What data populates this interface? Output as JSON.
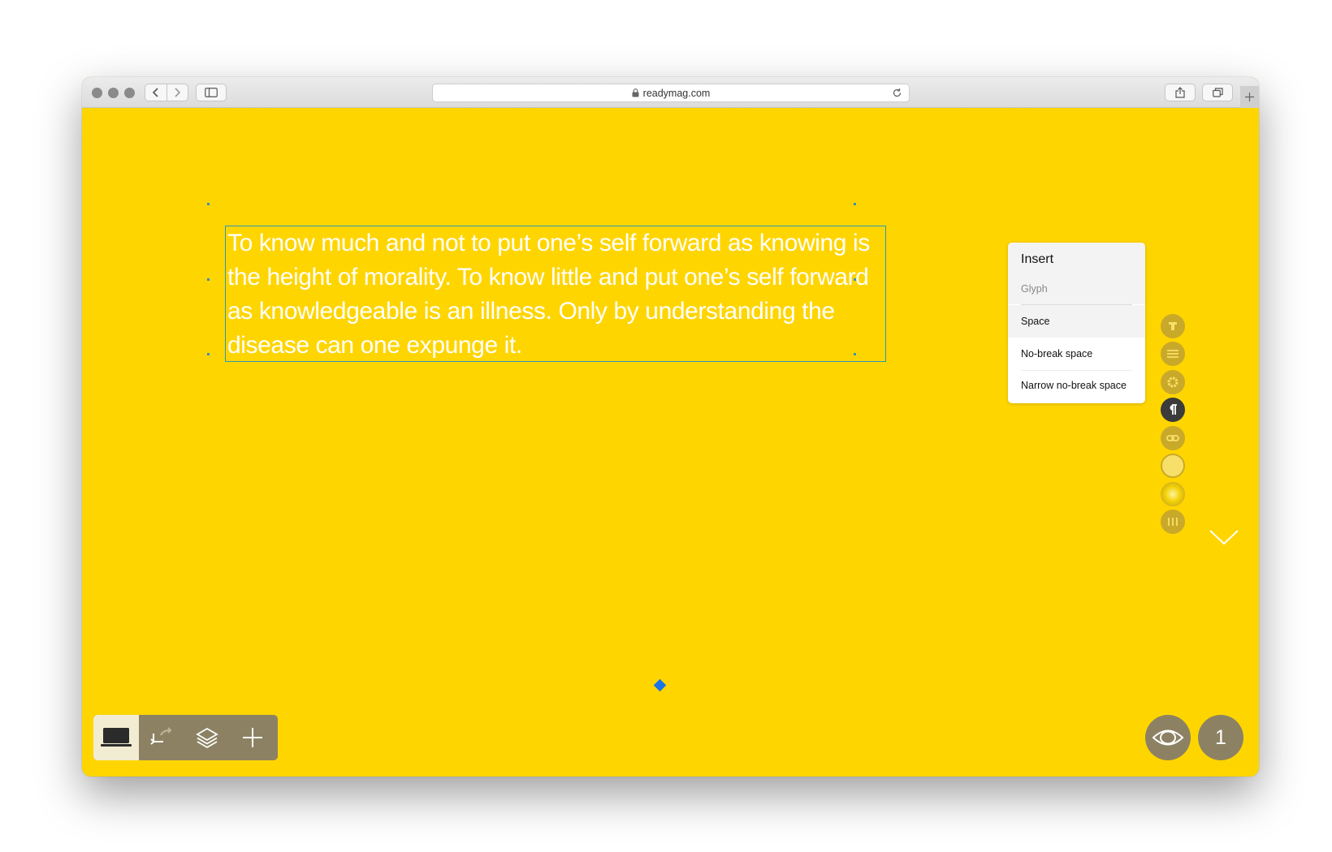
{
  "browser": {
    "url": "readymag.com"
  },
  "editor": {
    "text_block": "To know much and not to put one’s self forward as knowing is the height of morality. To know little and put one’s self forward as knowledgeable is an illness. Only by understanding the disease can one expunge it."
  },
  "insert_menu": {
    "title": "Insert",
    "subtitle": "Glyph",
    "items": [
      {
        "label": "Space"
      },
      {
        "label": "No-break space"
      },
      {
        "label": "Narrow no-break space"
      }
    ]
  },
  "right_tools": [
    {
      "icon": "text-type-icon"
    },
    {
      "icon": "align-lines-icon"
    },
    {
      "icon": "gear-icon"
    },
    {
      "icon": "paragraph-icon"
    },
    {
      "icon": "link-icon"
    },
    {
      "icon": "color-circle-icon"
    },
    {
      "icon": "glow-effect-icon"
    },
    {
      "icon": "columns-icon"
    }
  ],
  "page_indicator": "1",
  "colors": {
    "canvas": "#FFD500",
    "toolbar": "#8c8263",
    "tool_circle": "#C9A92A",
    "tool_active": "#3b3b3b",
    "selection": "#2b9ab4",
    "anchor": "#1a73e8"
  }
}
